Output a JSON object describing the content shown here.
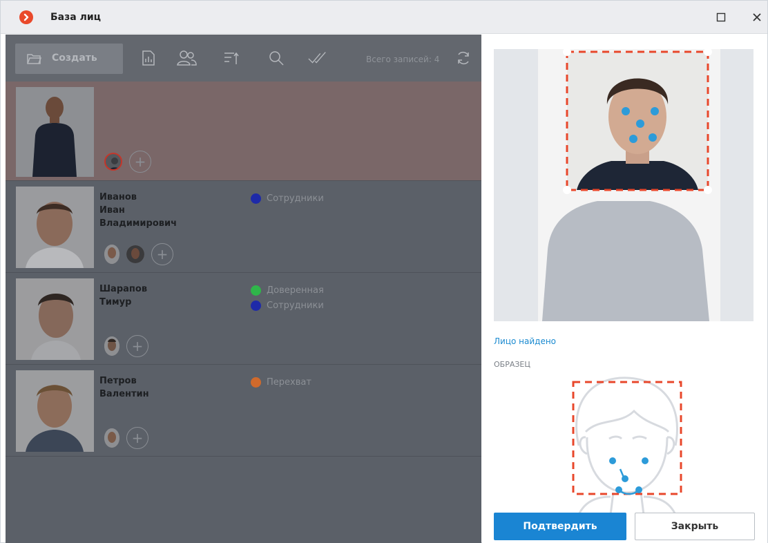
{
  "window": {
    "title": "База лиц"
  },
  "toolbar": {
    "create_label": "Создать",
    "total_label": "Всего записей: 4",
    "icons": [
      "report-icon",
      "persons-icon",
      "sort-icon",
      "search-icon",
      "check-all-icon",
      "refresh-icon"
    ]
  },
  "records": [
    {
      "name": "",
      "groups": []
    },
    {
      "name_lines": [
        "Иванов",
        "Иван",
        "Владимирович"
      ],
      "groups": [
        {
          "label": "Сотрудники",
          "color": "#1e2aa8"
        }
      ]
    },
    {
      "name_lines": [
        "Шарапов",
        "Тимур"
      ],
      "groups": [
        {
          "label": "Доверенная",
          "color": "#2fb64a"
        },
        {
          "label": "Сотрудники",
          "color": "#1e2aa8"
        }
      ]
    },
    {
      "name_lines": [
        "Петров",
        "Валентин"
      ],
      "groups": [
        {
          "label": "Перехват",
          "color": "#d06a2c"
        }
      ]
    }
  ],
  "panel": {
    "status": "Лицо найдено",
    "sample_label": "ОБРАЗЕЦ",
    "confirm_label": "Подтвердить",
    "close_label": "Закрыть"
  },
  "colors": {
    "accent": "#1a85d3",
    "face_frame": "#e8472b",
    "landmark": "#2d9bd9",
    "logo": "#e9492b"
  }
}
